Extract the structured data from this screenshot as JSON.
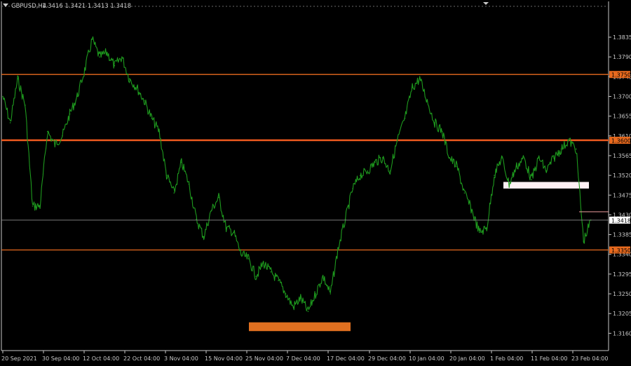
{
  "header": {
    "symbol_info": "GBPUSD,H4",
    "ohlc": "1.3416 1.3421 1.3413 1.3418"
  },
  "colors": {
    "background": "#000000",
    "price_line": "#1e9a1e",
    "axis": "#c8c8c8",
    "level": "#e86a1e",
    "level_strong": "#f05a1e",
    "support_box": "#e07020",
    "resistance_box": "#fff0f4"
  },
  "chart_data": {
    "type": "line",
    "title": "",
    "xlabel": "",
    "ylabel": "",
    "ylim": [
      1.3135,
      1.3875
    ],
    "y_ticks": [
      "1.3835",
      "1.3790",
      "1.3745",
      "1.3700",
      "1.3655",
      "1.3610",
      "1.3565",
      "1.3520",
      "1.3475",
      "1.3430",
      "1.3385",
      "1.3340",
      "1.3295",
      "1.3250",
      "1.3205",
      "1.3160"
    ],
    "x_ticks": [
      "20 Sep 2021",
      "30 Sep 04:00",
      "12 Oct 04:00",
      "22 Oct 04:00",
      "3 Nov 04:00",
      "15 Nov 04:00",
      "25 Nov 04:00",
      "7 Dec 04:00",
      "17 Dec 04:00",
      "29 Dec 04:00",
      "10 Jan 04:00",
      "20 Jan 04:00",
      "1 Feb 04:00",
      "11 Feb 04:00",
      "23 Feb 04:00"
    ],
    "current_price": "1.3418",
    "levels": [
      {
        "label": "1.3750",
        "value": 1.375
      },
      {
        "label": "1.3600",
        "value": 1.36
      },
      {
        "label": "1.3350",
        "value": 1.335
      }
    ],
    "zones": [
      {
        "kind": "support",
        "x_from": "25 Nov 04:00",
        "x_to": "17 Dec 04:00",
        "y_from": 1.3165,
        "y_to": 1.3185
      },
      {
        "kind": "resistance",
        "x_from": "1 Feb 04:00",
        "x_to": "23 Feb 04:00",
        "y_from": 1.349,
        "y_to": 1.3505
      }
    ],
    "series": [
      {
        "x": [
          "20 Sep 2021",
          "22 Sep 2021",
          "24 Sep 2021",
          "26 Sep 2021",
          "28 Sep 2021",
          "30 Sep 04:00",
          "2 Oct 2021",
          "4 Oct 2021",
          "6 Oct 2021",
          "8 Oct 2021",
          "10 Oct 2021",
          "12 Oct 04:00",
          "14 Oct 2021",
          "16 Oct 2021",
          "18 Oct 2021",
          "20 Oct 2021",
          "22 Oct 04:00",
          "24 Oct 2021",
          "26 Oct 2021",
          "28 Oct 2021",
          "30 Oct 2021",
          "1 Nov 2021",
          "3 Nov 04:00",
          "5 Nov 2021",
          "7 Nov 2021",
          "9 Nov 2021",
          "11 Nov 2021",
          "13 Nov 2021",
          "15 Nov 04:00",
          "17 Nov 2021",
          "19 Nov 2021",
          "21 Nov 2021",
          "23 Nov 2021",
          "25 Nov 04:00",
          "27 Nov 2021",
          "29 Nov 2021",
          "1 Dec 2021",
          "3 Dec 2021",
          "5 Dec 2021",
          "7 Dec 04:00",
          "9 Dec 2021",
          "11 Dec 2021",
          "13 Dec 2021",
          "15 Dec 2021",
          "17 Dec 04:00",
          "19 Dec 2021",
          "21 Dec 2021",
          "23 Dec 2021",
          "25 Dec 2021",
          "27 Dec 2021",
          "29 Dec 04:00",
          "31 Dec 2021",
          "2 Jan 2022",
          "4 Jan 2022",
          "6 Jan 2022",
          "8 Jan 2022",
          "10 Jan 04:00",
          "12 Jan 2022",
          "14 Jan 2022",
          "16 Jan 2022",
          "18 Jan 2022",
          "20 Jan 04:00",
          "22 Jan 2022",
          "24 Jan 2022",
          "26 Jan 2022",
          "28 Jan 2022",
          "30 Jan 2022",
          "1 Feb 04:00",
          "3 Feb 2022",
          "5 Feb 2022",
          "7 Feb 2022",
          "9 Feb 2022",
          "11 Feb 04:00",
          "13 Feb 2022",
          "15 Feb 2022",
          "17 Feb 2022",
          "19 Feb 2022",
          "21 Feb 2022",
          "23 Feb 04:00",
          "25 Feb 2022"
        ],
        "values": [
          1.37,
          1.364,
          1.374,
          1.368,
          1.345,
          1.345,
          1.362,
          1.359,
          1.361,
          1.366,
          1.37,
          1.376,
          1.383,
          1.379,
          1.38,
          1.377,
          1.379,
          1.374,
          1.372,
          1.369,
          1.365,
          1.362,
          1.352,
          1.348,
          1.355,
          1.35,
          1.342,
          1.338,
          1.344,
          1.347,
          1.34,
          1.339,
          1.334,
          1.333,
          1.329,
          1.332,
          1.33,
          1.328,
          1.325,
          1.322,
          1.324,
          1.321,
          1.325,
          1.329,
          1.325,
          1.335,
          1.342,
          1.349,
          1.352,
          1.353,
          1.355,
          1.356,
          1.353,
          1.36,
          1.365,
          1.372,
          1.374,
          1.369,
          1.364,
          1.362,
          1.356,
          1.354,
          1.348,
          1.344,
          1.339,
          1.34,
          1.352,
          1.356,
          1.35,
          1.354,
          1.356,
          1.351,
          1.356,
          1.353,
          1.356,
          1.358,
          1.36,
          1.358,
          1.337,
          1.3418
        ]
      }
    ]
  }
}
